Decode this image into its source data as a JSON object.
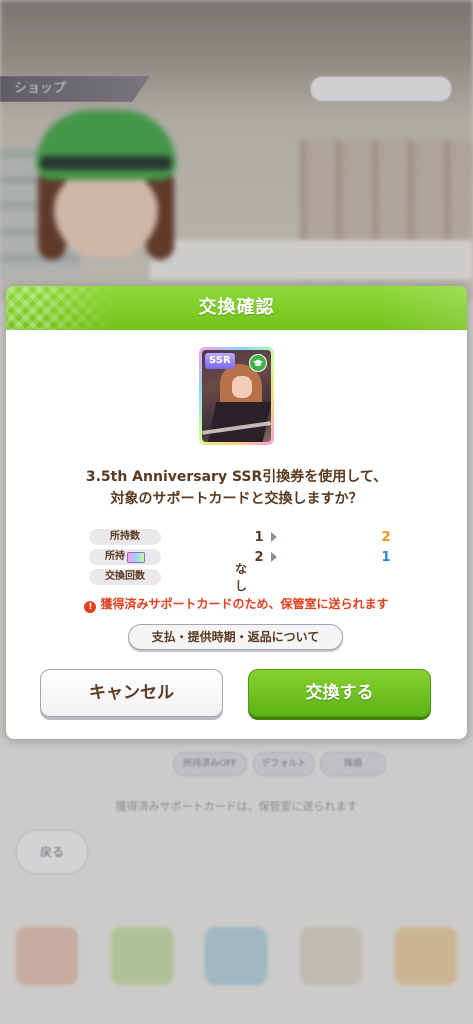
{
  "background": {
    "shop_tab_label": "ショップ",
    "footer_buttons": [
      "所持済みOFF",
      "デフォルト",
      "降順"
    ],
    "footer_notice": "獲得済みサポートカードは、保管室に送られます",
    "back_label": "戻る"
  },
  "dialog": {
    "title": "交換確認",
    "card": {
      "rarity": "SSR",
      "type_icon": "graduation-cap-icon"
    },
    "message_line1": "3.5th Anniversary SSR引換券を使用して、",
    "message_line2": "対象のサポートカードと交換しますか？",
    "info": {
      "owned_count": {
        "label": "所持数",
        "before": "1",
        "after": "2"
      },
      "ticket": {
        "label": "所持",
        "ticket_icon": "ssr-ticket-icon",
        "before": "2",
        "after": "1"
      },
      "exchange_count": {
        "label": "交換回数",
        "value": "なし"
      }
    },
    "warning_text": "獲得済みサポートカードのため、保管室に送られます",
    "policy_button_label": "支払・提供時期・返品について",
    "cancel_label": "キャンセル",
    "confirm_label": "交換する"
  },
  "colors": {
    "header_green": "#73c218",
    "confirm_green": "#5db315",
    "warning_red": "#e2401f",
    "after_orange": "#f0901a",
    "after_blue": "#2b86d8",
    "text_brown": "#5a3a20"
  }
}
